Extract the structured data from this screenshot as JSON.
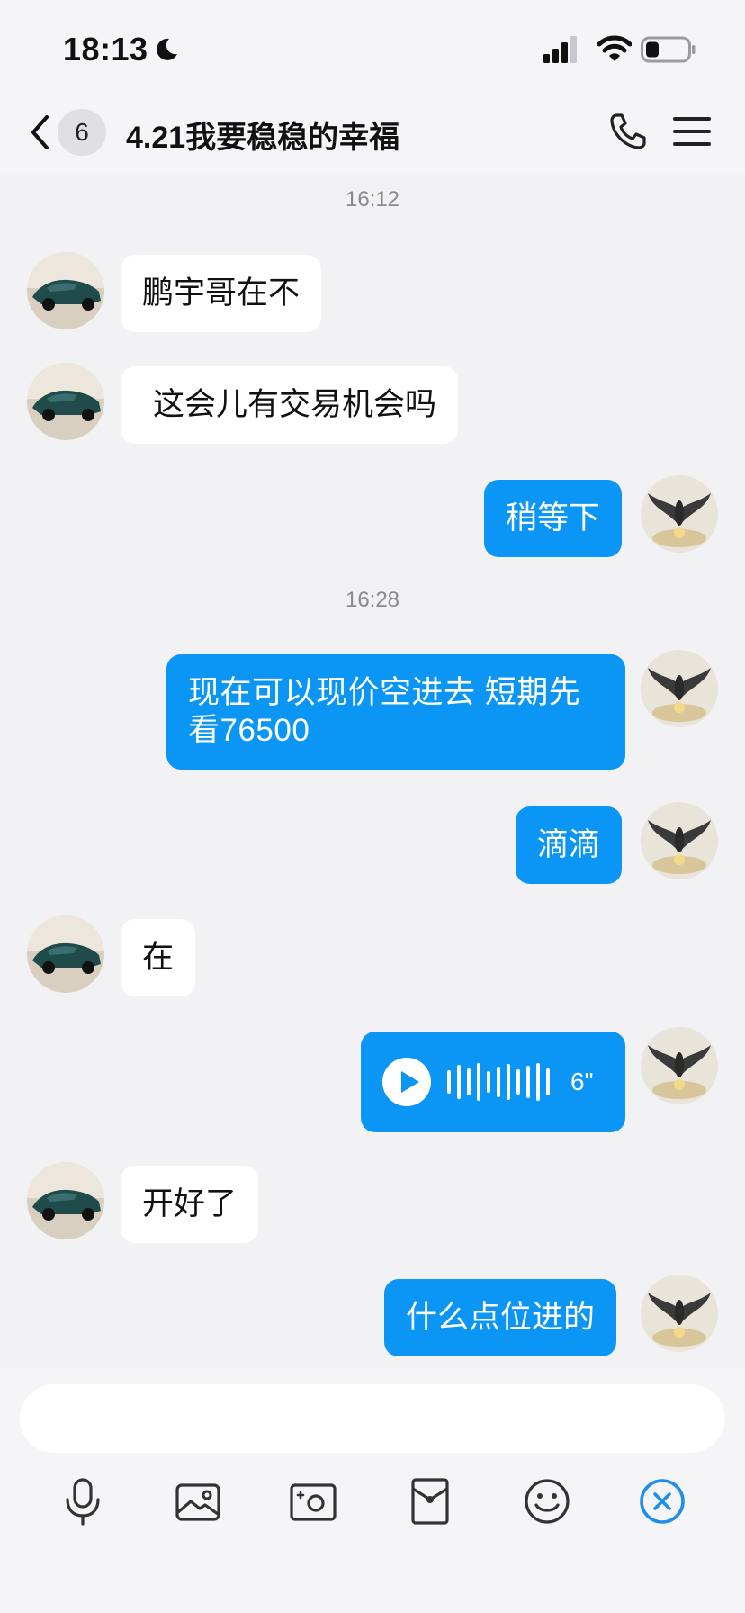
{
  "status": {
    "time": "18:13"
  },
  "header": {
    "unread_count": "6",
    "title": "4.21我要稳稳的幸福"
  },
  "messages": [
    {
      "kind": "timestamp",
      "text": "16:12"
    },
    {
      "kind": "text",
      "side": "in",
      "text": "鹏宇哥在不"
    },
    {
      "kind": "text",
      "side": "in",
      "text": "这会儿有交易机会吗"
    },
    {
      "kind": "text",
      "side": "out",
      "text": "稍等下"
    },
    {
      "kind": "timestamp",
      "text": "16:28"
    },
    {
      "kind": "text",
      "side": "out",
      "text": "现在可以现价空进去  短期先看76500"
    },
    {
      "kind": "text",
      "side": "out",
      "text": "滴滴"
    },
    {
      "kind": "text",
      "side": "in",
      "text": "在"
    },
    {
      "kind": "voice",
      "side": "out",
      "duration": "6\""
    },
    {
      "kind": "text",
      "side": "in",
      "text": "开好了"
    },
    {
      "kind": "text",
      "side": "out",
      "text": "什么点位进的"
    }
  ],
  "input": {
    "value": "",
    "placeholder": ""
  },
  "toolbar": [
    "microphone-icon",
    "photo-icon",
    "camera-icon",
    "red-packet-icon",
    "emoji-icon",
    "close-circle-icon"
  ],
  "colors": {
    "outgoing_bubble": "#0b95f5",
    "incoming_bubble": "#ffffff",
    "background": "#f2f2f4",
    "accent": "#1a8ff0"
  }
}
